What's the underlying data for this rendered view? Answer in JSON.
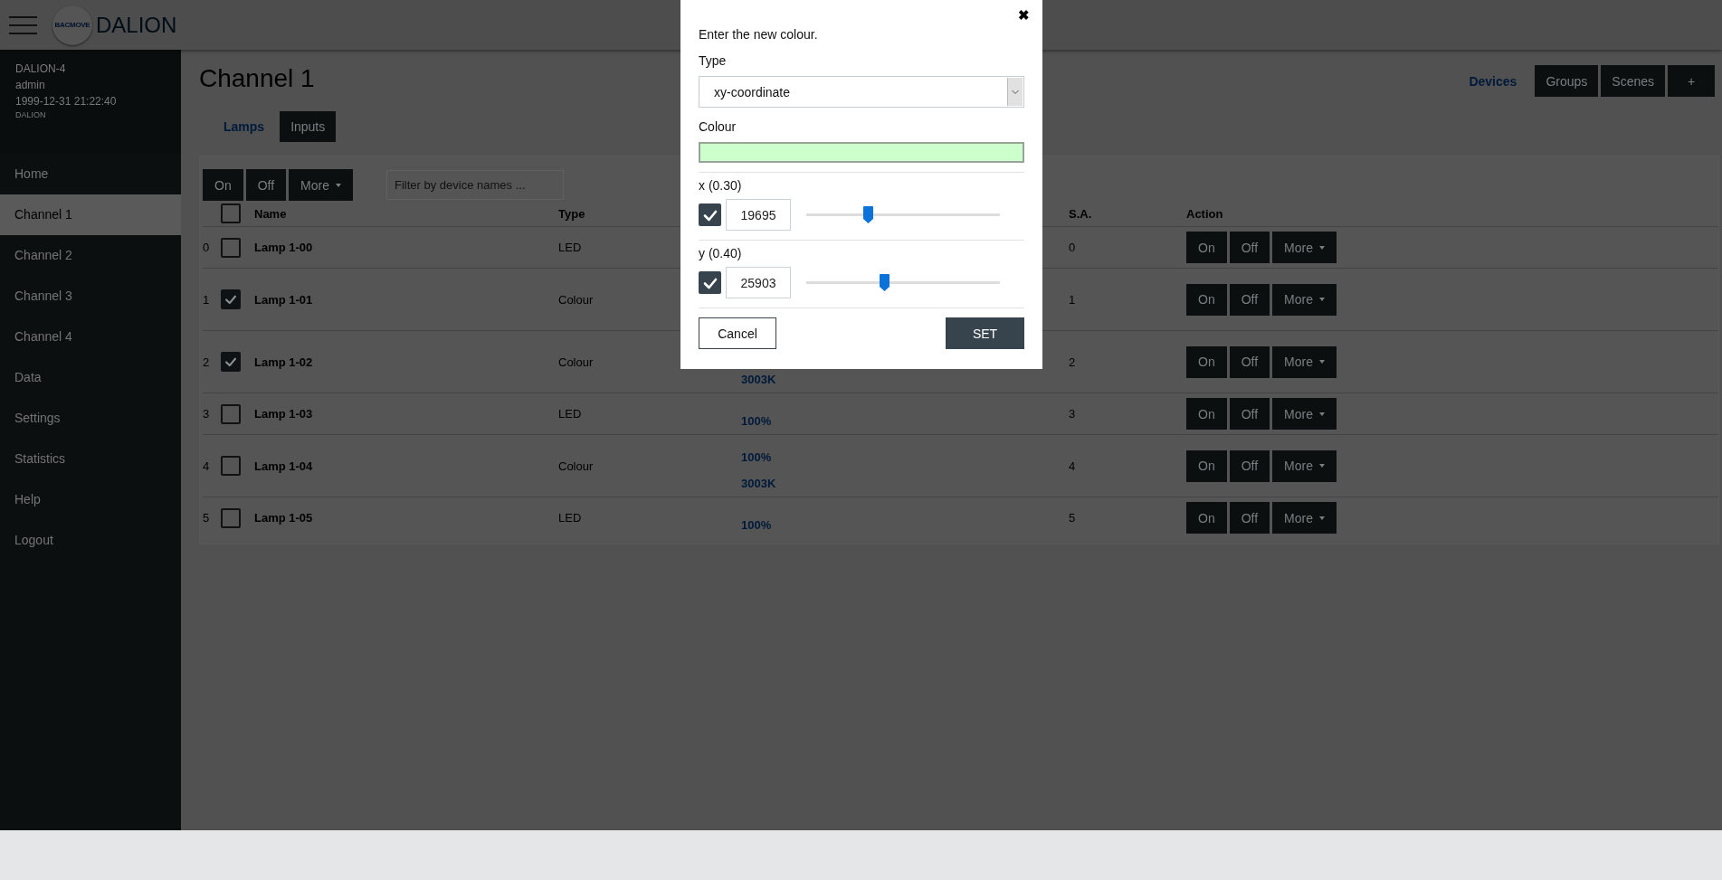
{
  "header": {
    "logo_badge": "BACMOVE",
    "brand": "DALION"
  },
  "sidebar": {
    "device": "DALION-4",
    "user": "admin",
    "datetime": "1999-12-31 21:22:40",
    "system": "DALION",
    "items": [
      {
        "label": "Home",
        "selected": false
      },
      {
        "label": "Channel 1",
        "selected": true
      },
      {
        "label": "Channel 2",
        "selected": false
      },
      {
        "label": "Channel 3",
        "selected": false
      },
      {
        "label": "Channel 4",
        "selected": false
      },
      {
        "label": "Data",
        "selected": false
      },
      {
        "label": "Settings",
        "selected": false
      },
      {
        "label": "Statistics",
        "selected": false
      },
      {
        "label": "Help",
        "selected": false
      },
      {
        "label": "Logout",
        "selected": false
      }
    ]
  },
  "page": {
    "title": "Channel 1",
    "view_tabs": [
      {
        "label": "Devices",
        "selected": true
      },
      {
        "label": "Groups",
        "selected": false
      },
      {
        "label": "Scenes",
        "selected": false
      },
      {
        "label": "+",
        "selected": false
      }
    ],
    "tabs": [
      {
        "label": "Lamps",
        "selected": true
      },
      {
        "label": "Inputs",
        "selected": false
      }
    ]
  },
  "toolbar": {
    "buttons": [
      "On",
      "Off",
      "More"
    ],
    "filter_placeholder": "Filter by device names ..."
  },
  "table": {
    "header_checked": false,
    "columns": [
      {
        "label": "Name"
      },
      {
        "label": "Type"
      },
      {
        "label": "S.A."
      },
      {
        "label": "Action"
      }
    ],
    "rows": [
      {
        "index": "0",
        "checked": false,
        "name": "Lamp 1-00",
        "type": "LED",
        "sa": "0",
        "actions": [
          "On",
          "Off",
          "More"
        ]
      },
      {
        "index": "1",
        "checked": true,
        "name": "Lamp 1-01",
        "type": "Colour",
        "sa": "1",
        "actions": [
          "On",
          "Off",
          "More"
        ]
      },
      {
        "index": "2",
        "checked": true,
        "name": "Lamp 1-02",
        "type": "Colour",
        "values": [
          "3003K"
        ],
        "sa": "2",
        "actions": [
          "On",
          "Off",
          "More"
        ]
      },
      {
        "index": "3",
        "checked": false,
        "name": "Lamp 1-03",
        "type": "LED",
        "values": [
          "100%"
        ],
        "sa": "3",
        "actions": [
          "On",
          "Off",
          "More"
        ]
      },
      {
        "index": "4",
        "checked": false,
        "name": "Lamp 1-04",
        "type": "Colour",
        "values": [
          "100%",
          "3003K"
        ],
        "sa": "4",
        "actions": [
          "On",
          "Off",
          "More"
        ]
      },
      {
        "index": "5",
        "checked": false,
        "name": "Lamp 1-05",
        "type": "LED",
        "values": [
          "100%"
        ],
        "sa": "5",
        "actions": [
          "On",
          "Off",
          "More"
        ]
      }
    ]
  },
  "dialog": {
    "close": "✖",
    "prompt": "Enter the new colour.",
    "type_label": "Type",
    "type_value": "xy-coordinate",
    "colour_label": "Colour",
    "channels": [
      {
        "label": "x (0.30)",
        "checked": true,
        "value": "19695",
        "level": 0.32
      },
      {
        "label": "y (0.40)",
        "checked": true,
        "value": "25903",
        "level": 0.4
      }
    ],
    "cancel": "Cancel",
    "set": "SET"
  }
}
